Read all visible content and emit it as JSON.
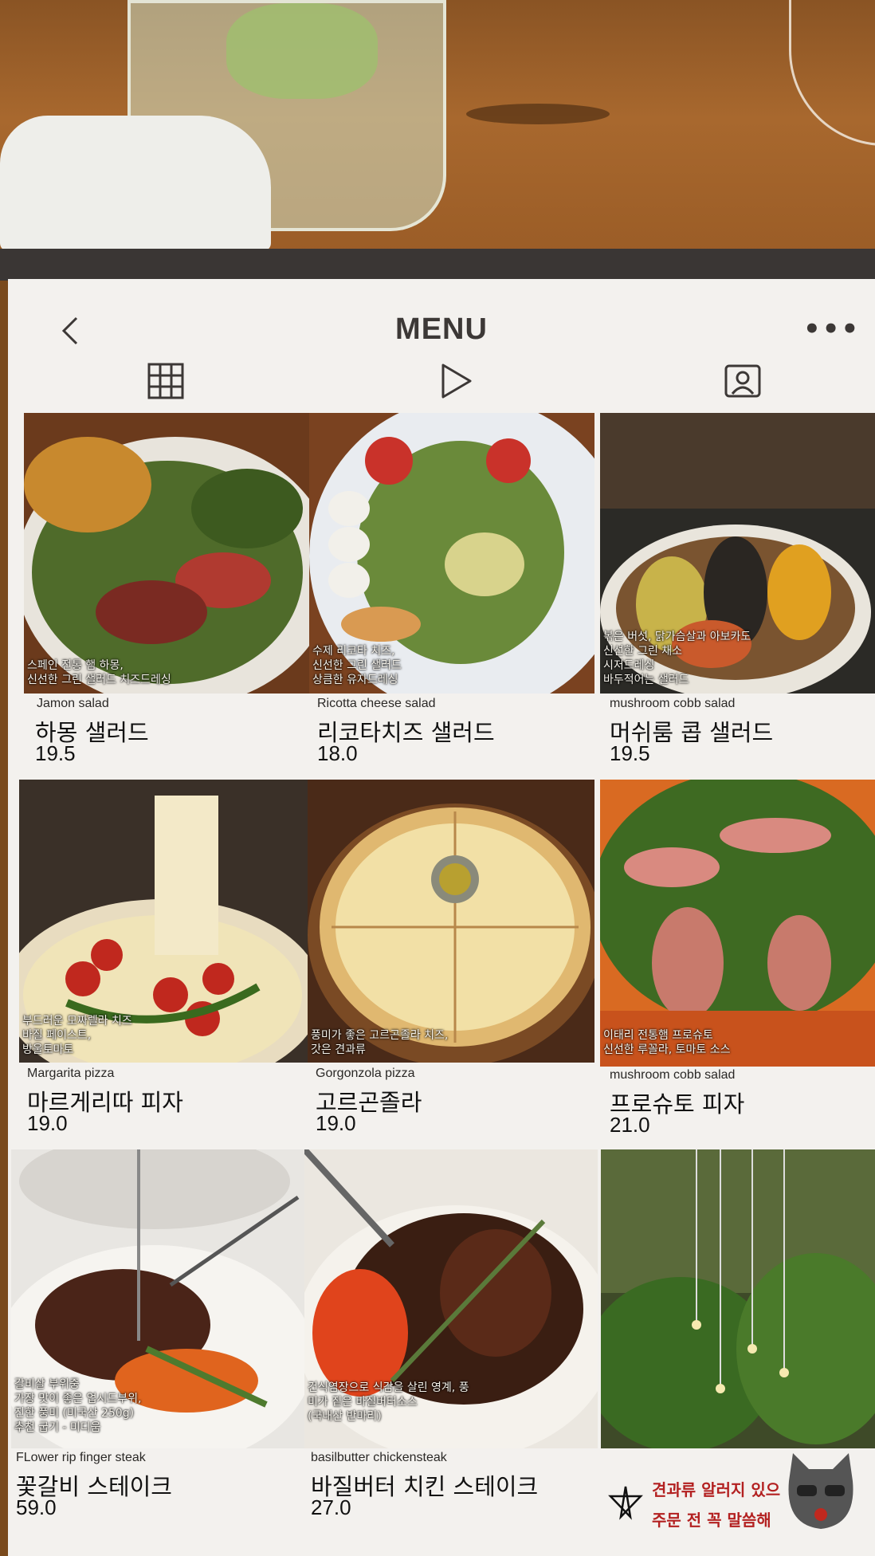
{
  "header": {
    "title": "MENU",
    "icons": [
      "back-icon",
      "more-icon",
      "grid-icon",
      "play-icon",
      "tag-icon"
    ]
  },
  "menu": [
    {
      "caption": "스페인 전통 햄 하몽,\n신선한 그린 샐러드 치즈드레싱",
      "en": "Jamon salad",
      "ko": "하몽 샐러드",
      "price": "19.5"
    },
    {
      "caption": "수제 리코타 치즈,\n신선한 그린 샐러드\n상큼한 유자드레싱",
      "en": "Ricotta cheese salad",
      "ko": "리코타치즈 샐러드",
      "price": "18.0"
    },
    {
      "caption": "볶은 버섯, 닭가슴살과 아보카도\n신선한 그린 채소\n시저드레싱\n바두적어는 샐러드",
      "en": "mushroom cobb salad",
      "ko": "머쉬룸 콥 샐러드",
      "price": "19.5"
    },
    {
      "caption": "부드러운 모짜렐라 치즈\n바질 페이스트,\n방울토마토",
      "en": "Margarita pizza",
      "ko": "마르게리따 피자",
      "price": "19.0"
    },
    {
      "caption": "풍미가 좋은 고르곤졸라 치즈,\n갓은 견과류",
      "en": "Gorgonzola pizza",
      "ko": "고르곤졸라",
      "price": "19.0"
    },
    {
      "caption": "이태리 전통햄 프로슈토\n신선한 루꼴라, 토마토 소스",
      "en": "mushroom cobb salad",
      "ko": "프로슈토 피자",
      "price": "21.0"
    },
    {
      "caption": "갈비살 부위중\n가장 맛이 좋은 업시드부위,\n진한 풍미 (미국산 250g)\n추천 굽기 - 미디움",
      "en": "FLower rip finger steak",
      "ko": "꽃갈비 스테이크",
      "price": "59.0"
    },
    {
      "caption": "건식염장으로 식감을 살린 영계, 풍\n미가 짙은 바질버터소스\n(국내산 반마리)",
      "en": "basilbutter chickensteak",
      "ko": "바질버터 치킨 스테이크",
      "price": "27.0"
    },
    {
      "caption": "",
      "en": "",
      "ko": "",
      "price": ""
    }
  ],
  "notice": {
    "line1": "견과류 알러지 있으",
    "line2": "주문 전 꼭 말씀해"
  },
  "colors": {
    "paper": "#f3f1ee",
    "notice": "#b32020",
    "text": "#111111"
  }
}
